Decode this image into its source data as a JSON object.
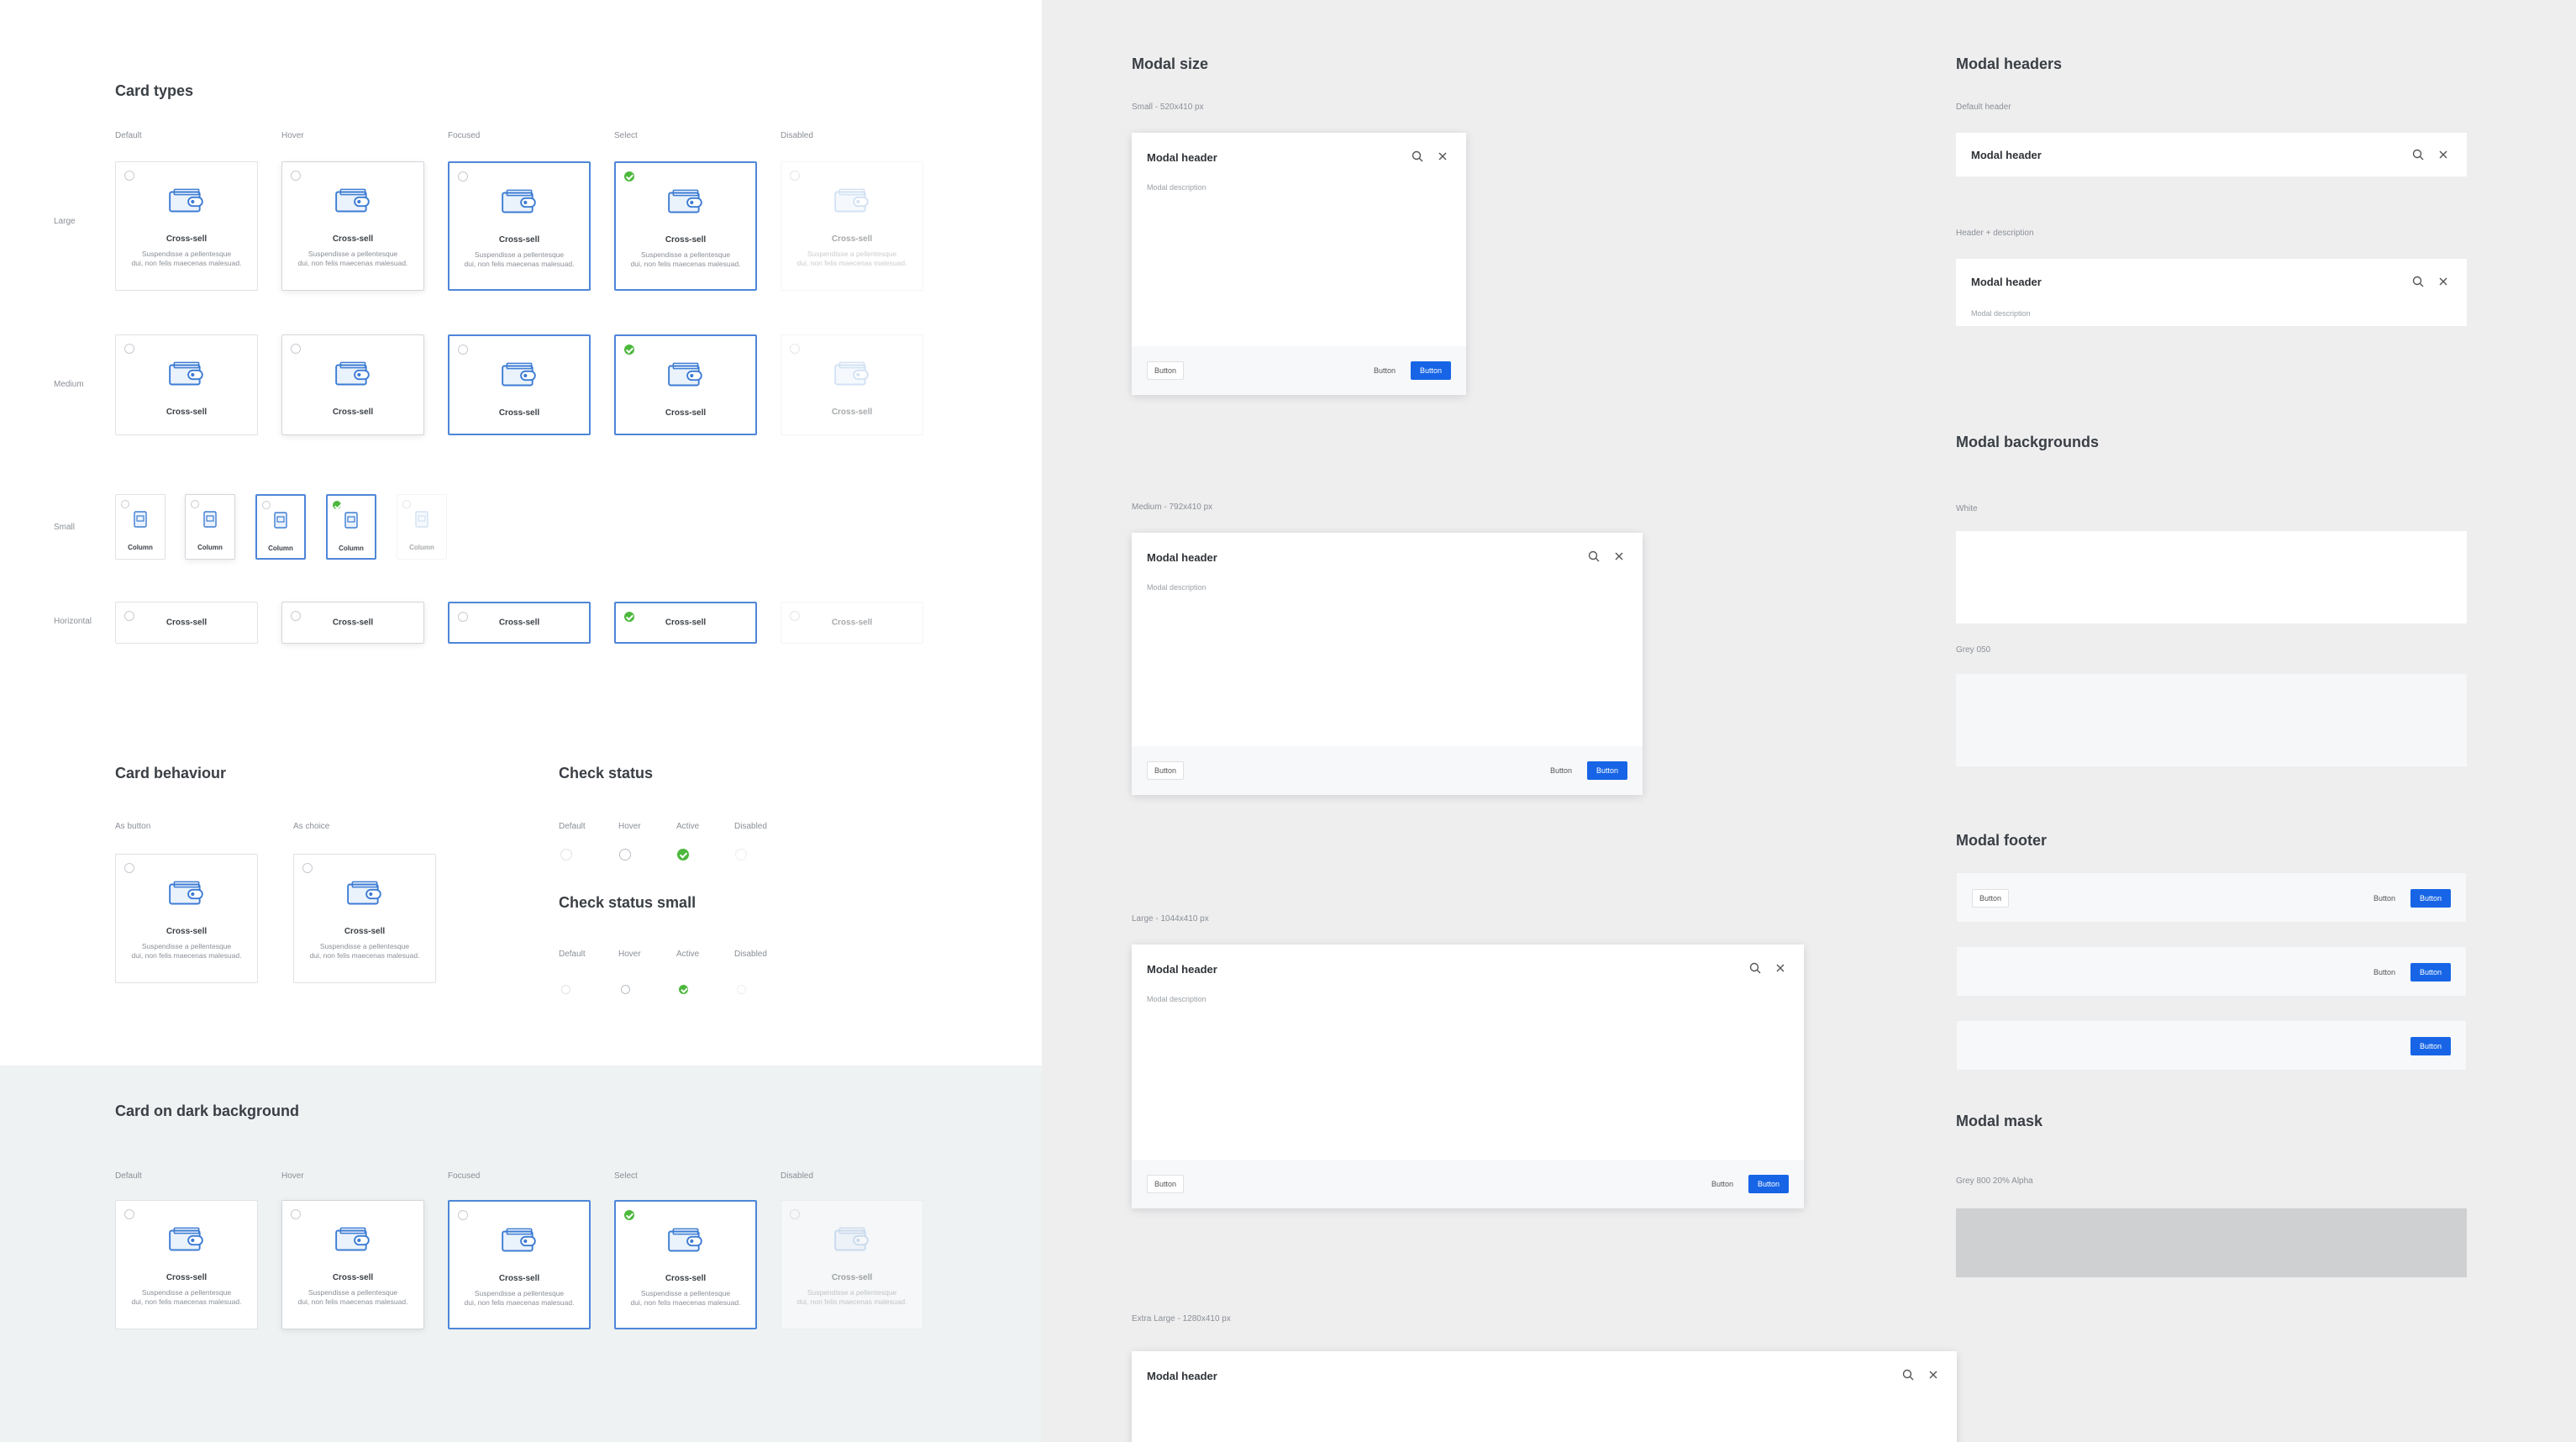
{
  "left": {
    "card_types": {
      "title": "Card types",
      "states": [
        "Default",
        "Hover",
        "Focused",
        "Select",
        "Disabled"
      ],
      "rows": [
        "Large",
        "Medium",
        "Small",
        "Horizontal"
      ],
      "card_title": "Cross-sell",
      "card_desc": "Suspendisse a pellentesque dui, non felis maecenas malesuad.",
      "card_desc_line1": "Suspendisse a pellentesque",
      "card_desc_line2": "dui, non felis maecenas malesuad.",
      "small_title": "Column"
    },
    "card_behaviour": {
      "title": "Card behaviour",
      "labels": [
        "As button",
        "As choice"
      ]
    },
    "check_status": {
      "title": "Check status",
      "title_small": "Check status small",
      "states": [
        "Default",
        "Hover",
        "Active",
        "Disabled"
      ]
    },
    "dark": {
      "title": "Card on dark background"
    }
  },
  "right": {
    "modal_size": {
      "title": "Modal size",
      "small": "Small - 520x410 px",
      "medium": "Medium - 792x410 px",
      "large": "Large - 1044x410 px",
      "xlarge": "Extra Large - 1280x410 px"
    },
    "modal": {
      "header": "Modal header",
      "description": "Modal description",
      "button": "Button"
    },
    "modal_headers": {
      "title": "Modal headers",
      "default": "Default header",
      "with_desc": "Header + description"
    },
    "modal_backgrounds": {
      "title": "Modal backgrounds",
      "white": "White",
      "grey": "Grey 050"
    },
    "modal_footer": {
      "title": "Modal footer"
    },
    "modal_mask": {
      "title": "Modal mask",
      "label": "Grey 800 20% Alpha"
    }
  },
  "colors": {
    "primary": "#1765e6",
    "selected": "#4e86d8",
    "success": "#4cb83c",
    "mask": "#cfd0d2"
  }
}
